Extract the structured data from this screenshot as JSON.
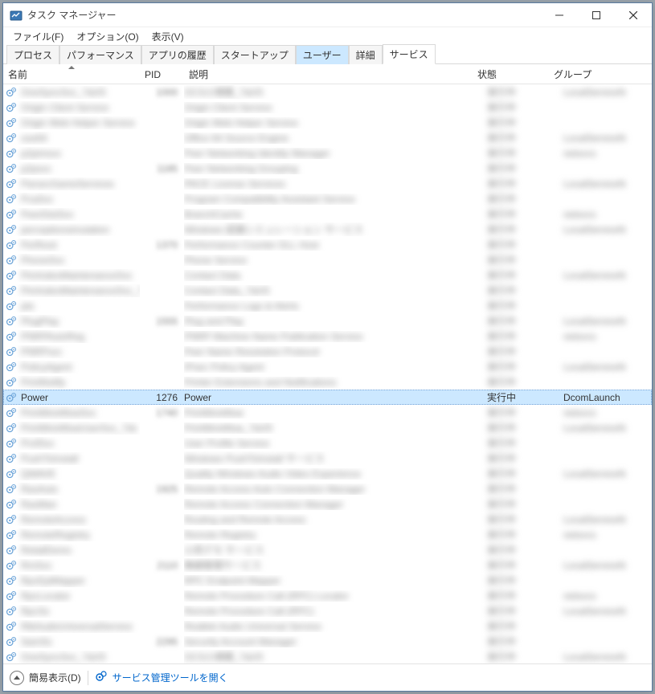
{
  "window": {
    "title": "タスク マネージャー"
  },
  "menu": {
    "file": "ファイル(F)",
    "options": "オプション(O)",
    "view": "表示(V)"
  },
  "tabs": [
    {
      "label": "プロセス",
      "state": "normal"
    },
    {
      "label": "パフォーマンス",
      "state": "normal"
    },
    {
      "label": "アプリの履歴",
      "state": "normal"
    },
    {
      "label": "スタートアップ",
      "state": "normal"
    },
    {
      "label": "ユーザー",
      "state": "highlight"
    },
    {
      "label": "詳細",
      "state": "normal"
    },
    {
      "label": "サービス",
      "state": "active"
    }
  ],
  "columns": {
    "name": "名前",
    "pid": "PID",
    "desc": "説明",
    "status": "状態",
    "group": "グループ"
  },
  "selected_row": {
    "name": "Power",
    "pid": "1276",
    "desc": "Power",
    "status": "実行中",
    "group": "DcomLaunch"
  },
  "statusbar": {
    "fewer_details": "簡易表示(D)",
    "open_services": "サービス管理ツールを開く"
  },
  "blurred_rows_before": 20,
  "blurred_rows_after": 17
}
